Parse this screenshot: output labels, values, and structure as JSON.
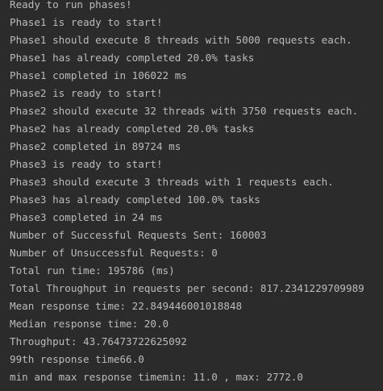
{
  "console": {
    "lines": [
      "Ready to run phases!",
      "Phase1 is ready to start!",
      "Phase1 should execute 8 threads with 5000 requests each.",
      "Phase1 has already completed 20.0% tasks",
      "Phase1 completed in 106022 ms",
      "Phase2 is ready to start!",
      "Phase2 should execute 32 threads with 3750 requests each.",
      "Phase2 has already completed 20.0% tasks",
      "Phase2 completed in 89724 ms",
      "Phase3 is ready to start!",
      "Phase3 should execute 3 threads with 1 requests each.",
      "Phase3 has already completed 100.0% tasks",
      "Phase3 completed in 24 ms",
      "Number of Successful Requests Sent: 160003",
      "Number of Unsuccessful Requests: 0",
      "Total run time: 195786 (ms)",
      "Total Throughput in requests per second: 817.2341229709989",
      "Mean response time: 22.849446001018848",
      "Median response time: 20.0",
      "Throughput: 43.76473722625092",
      "99th response time66.0",
      "min and max response timemin: 11.0 , max: 2772.0"
    ]
  },
  "colors": {
    "background": "#2b2b2b",
    "text": "#bbbbbb"
  }
}
